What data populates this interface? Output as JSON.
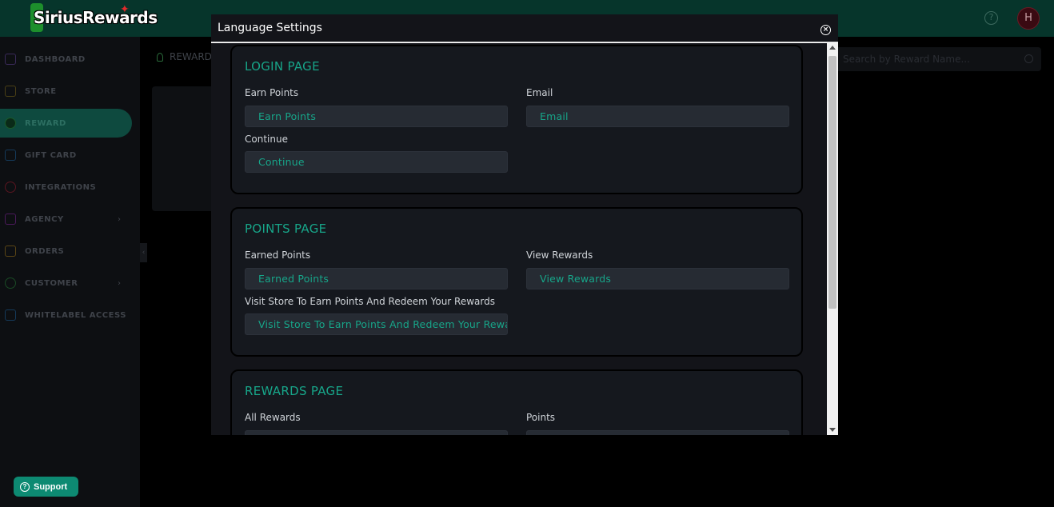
{
  "app": {
    "logo_text": "SiriusRewards",
    "avatar_initial": "H"
  },
  "sidebar": {
    "items": [
      {
        "label": "DASHBOARD",
        "icon": "dashboard-icon",
        "color": "#5b3a8c"
      },
      {
        "label": "STORE",
        "icon": "store-icon",
        "color": "#7a6a1a"
      },
      {
        "label": "REWARD",
        "icon": "reward-icon",
        "color": "#2a8a4a",
        "active": true
      },
      {
        "label": "GIFT CARD",
        "icon": "gift-card-icon",
        "color": "#1a4f7a"
      },
      {
        "label": "INTEGRATIONS",
        "icon": "integrations-icon",
        "color": "#8a1a2a"
      },
      {
        "label": "AGENCY",
        "icon": "agency-icon",
        "color": "#6a2a8a",
        "chevron": true
      },
      {
        "label": "ORDERS",
        "icon": "orders-icon",
        "color": "#8a6a1a"
      },
      {
        "label": "CUSTOMER",
        "icon": "customer-icon",
        "color": "#2a6a3a",
        "chevron": true
      },
      {
        "label": "WHITELABEL ACCESS",
        "icon": "whitelabel-icon",
        "color": "#1a4f7a"
      }
    ],
    "support_label": "Support"
  },
  "main": {
    "breadcrumb": "REWARD",
    "search_placeholder": "Search by Reward Name..."
  },
  "modal": {
    "title": "Language Settings",
    "sections": [
      {
        "title": "LOGIN PAGE",
        "fields": [
          {
            "label": "Earn Points",
            "value": "Earn Points"
          },
          {
            "label": "Email",
            "value": "Email"
          },
          {
            "label": "Continue",
            "value": "Continue"
          }
        ]
      },
      {
        "title": "POINTS PAGE",
        "fields": [
          {
            "label": "Earned Points",
            "value": "Earned Points"
          },
          {
            "label": "View Rewards",
            "value": "View Rewards"
          },
          {
            "label": "Visit Store To Earn Points And Redeem Your Rewards",
            "value": "Visit Store To Earn Points And Redeem Your Rewards"
          }
        ]
      },
      {
        "title": "REWARDS PAGE",
        "fields": [
          {
            "label": "All Rewards",
            "value": ""
          },
          {
            "label": "Points",
            "value": ""
          }
        ]
      }
    ]
  },
  "colors": {
    "accent": "#17a589",
    "topbar": "#06352b",
    "modal_bg": "#131419",
    "support": "#0d8a72"
  }
}
